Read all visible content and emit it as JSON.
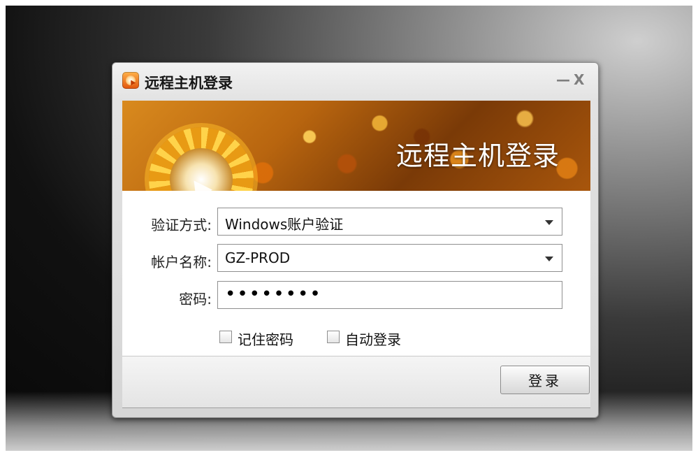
{
  "window": {
    "title": "远程主机登录",
    "minimize_glyph": "—",
    "close_glyph": "X"
  },
  "banner": {
    "title": "远程主机登录"
  },
  "form": {
    "auth_method": {
      "label": "验证方式:",
      "value": "Windows账户验证"
    },
    "account_name": {
      "label": "帐户名称:",
      "value": "GZ-PROD"
    },
    "password": {
      "label": "密码:",
      "value": "••••••••"
    },
    "remember_password": {
      "label": "记住密码",
      "checked": false
    },
    "auto_login": {
      "label": "自动登录",
      "checked": false
    }
  },
  "footer": {
    "login_label": "登录"
  },
  "icons": {
    "app": "remote-host-icon",
    "dropdown": "chevron-down-icon"
  },
  "colors": {
    "banner_accent": "#d98a1e",
    "window_bg": "#e2e2e2",
    "desktop_bg": "#111111"
  }
}
